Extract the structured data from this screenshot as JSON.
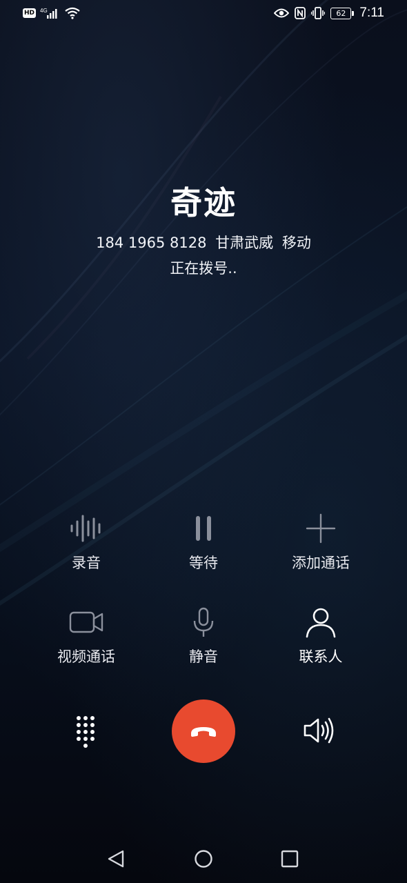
{
  "status_bar": {
    "hd": "HD",
    "network": "4G",
    "battery": "62",
    "time": "7:11",
    "icons": [
      "hd-icon",
      "signal-icon",
      "wifi-icon",
      "eye-icon",
      "nfc-icon",
      "vibrate-icon",
      "battery-icon"
    ]
  },
  "caller": {
    "name": "奇迹",
    "number": "184 1965 8128",
    "location": "甘肃武威",
    "carrier": "移动",
    "status": "正在拨号.."
  },
  "actions": {
    "record": {
      "label": "录音",
      "icon": "waveform-icon"
    },
    "hold": {
      "label": "等待",
      "icon": "pause-icon"
    },
    "add_call": {
      "label": "添加通话",
      "icon": "plus-icon"
    },
    "video_call": {
      "label": "视频通话",
      "icon": "video-camera-icon"
    },
    "mute": {
      "label": "静音",
      "icon": "microphone-icon"
    },
    "contacts": {
      "label": "联系人",
      "icon": "person-icon"
    }
  },
  "controls": {
    "dialpad": "dialpad-icon",
    "end_call": "phone-hangup-icon",
    "speaker": "speaker-icon"
  },
  "colors": {
    "end_call": "#e84a2f",
    "disabled_icon": "#8b909c",
    "background": "#070b16"
  },
  "nav": [
    "back-icon",
    "home-icon",
    "recents-icon"
  ]
}
